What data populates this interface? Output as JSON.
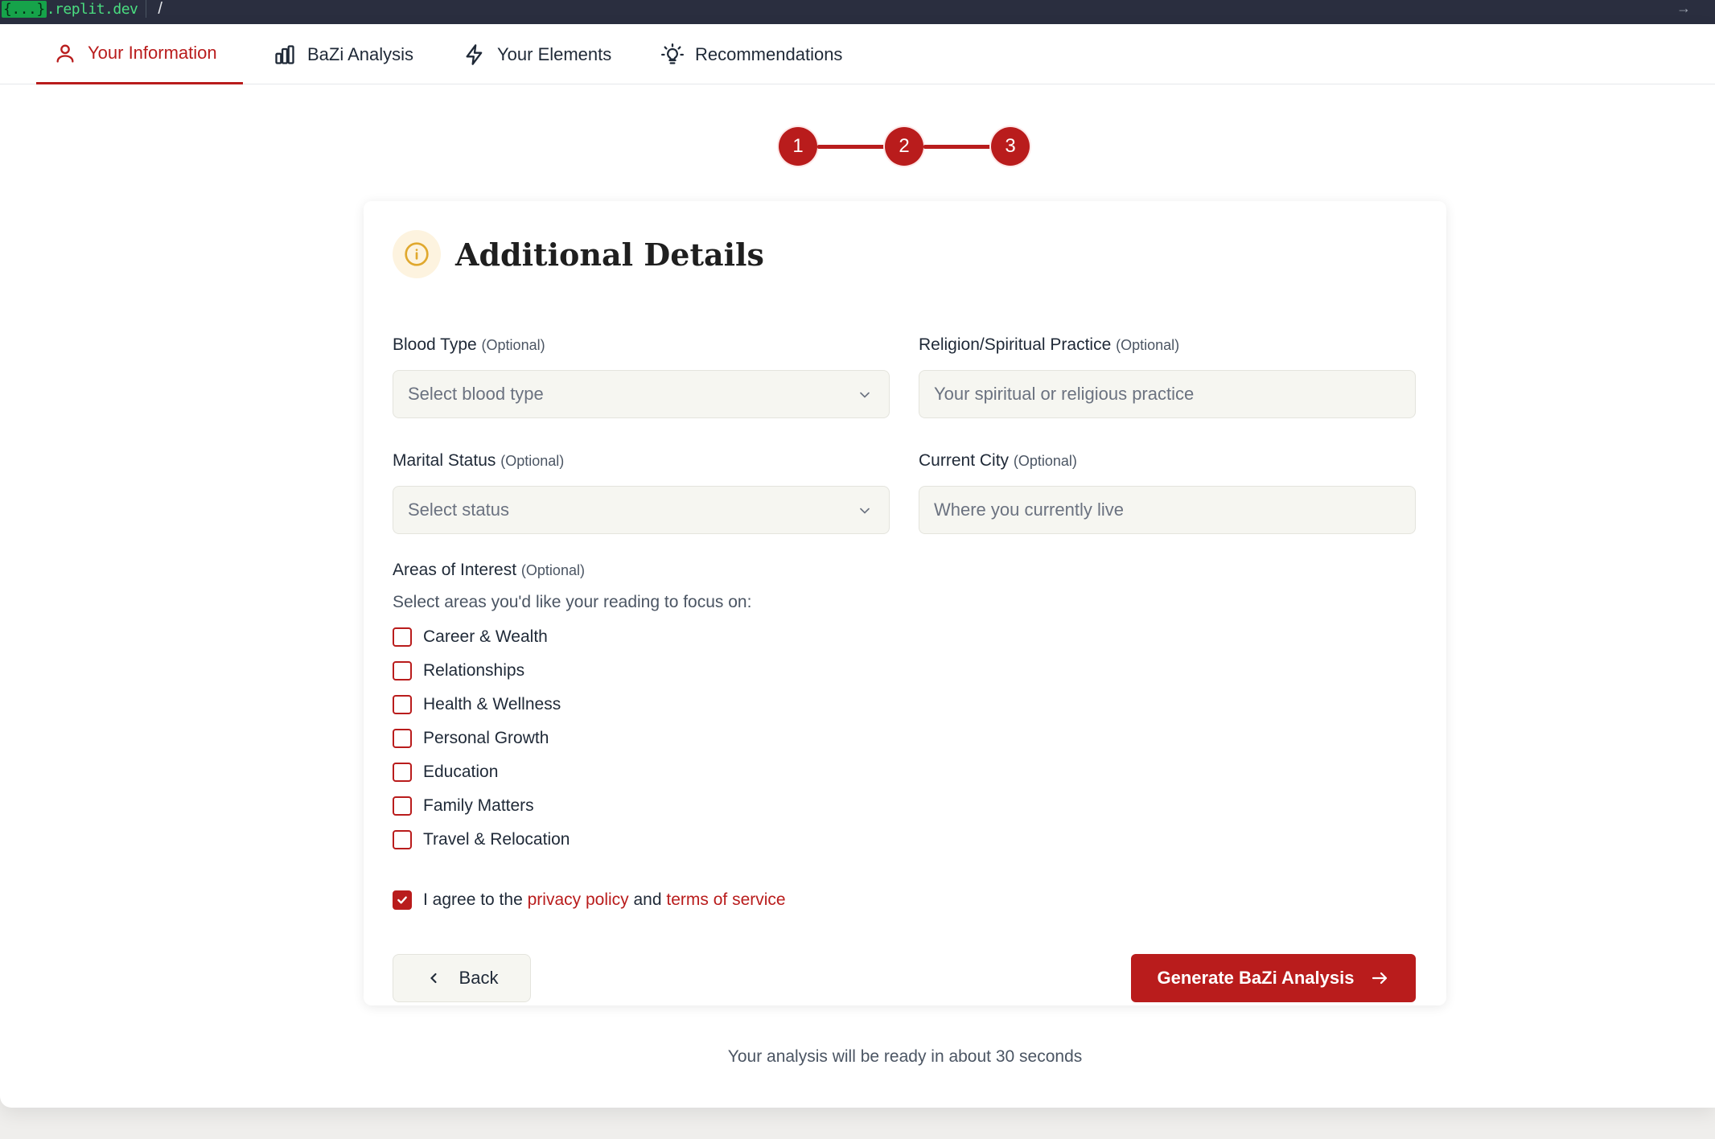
{
  "browser": {
    "url_brace": "{...}",
    "url_domain": ".replit.dev",
    "path": "/"
  },
  "tabs": [
    {
      "label": "Your Information",
      "icon": "user-icon",
      "active": true
    },
    {
      "label": "BaZi Analysis",
      "icon": "bar-chart-icon",
      "active": false
    },
    {
      "label": "Your Elements",
      "icon": "lightning-icon",
      "active": false
    },
    {
      "label": "Recommendations",
      "icon": "lightbulb-icon",
      "active": false
    }
  ],
  "stepper": {
    "steps": [
      "1",
      "2",
      "3"
    ]
  },
  "card": {
    "title": "Additional Details",
    "icon": "info-icon",
    "fields": {
      "blood_type": {
        "label": "Blood Type",
        "optional": "(Optional)",
        "placeholder": "Select blood type"
      },
      "religion": {
        "label": "Religion/Spiritual Practice",
        "optional": "(Optional)",
        "placeholder": "Your spiritual or religious practice"
      },
      "marital": {
        "label": "Marital Status",
        "optional": "(Optional)",
        "placeholder": "Select status"
      },
      "city": {
        "label": "Current City",
        "optional": "(Optional)",
        "placeholder": "Where you currently live"
      }
    },
    "interests": {
      "label": "Areas of Interest",
      "optional": "(Optional)",
      "hint": "Select areas you'd like your reading to focus on:",
      "options": [
        {
          "label": "Career & Wealth",
          "checked": false
        },
        {
          "label": "Relationships",
          "checked": false
        },
        {
          "label": "Health & Wellness",
          "checked": false
        },
        {
          "label": "Personal Growth",
          "checked": false
        },
        {
          "label": "Education",
          "checked": false
        },
        {
          "label": "Family Matters",
          "checked": false
        },
        {
          "label": "Travel & Relocation",
          "checked": false
        }
      ]
    },
    "agreement": {
      "checked": true,
      "prefix": "I agree to the",
      "privacy": "privacy policy",
      "and": "and",
      "terms": "terms of service"
    },
    "buttons": {
      "back": "Back",
      "generate": "Generate BaZi Analysis"
    }
  },
  "footer_note": "Your analysis will be ready in about 30 seconds",
  "colors": {
    "accent": "#b91c1c",
    "info_bg": "#fdf3df",
    "info_icon": "#e0a82e",
    "field_bg": "#f6f6f1"
  }
}
